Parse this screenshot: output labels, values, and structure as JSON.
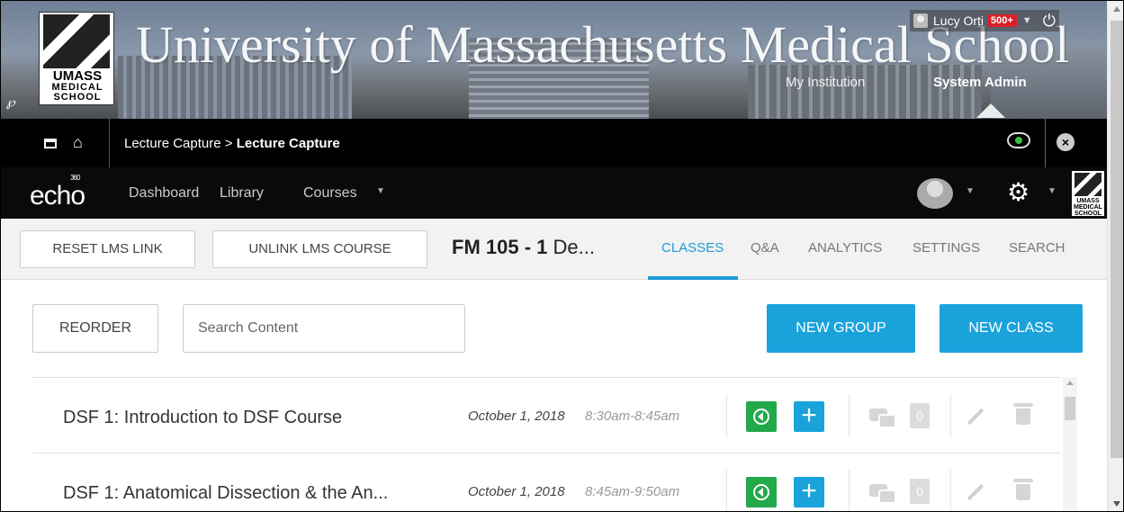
{
  "banner": {
    "title": "University of Massachusetts Medical School",
    "logo_lines": [
      "UMASS",
      "MEDICAL",
      "SCHOOL"
    ],
    "my_institution": "My Institution",
    "system_admin": "System Admin",
    "user_name": "Lucy Orti",
    "notification_count": "500+"
  },
  "breadcrumb": {
    "parent": "Lecture Capture",
    "separator": ">",
    "current": "Lecture Capture"
  },
  "echo": {
    "logo": "echo",
    "logo_sup": "360",
    "nav": [
      "Dashboard",
      "Library",
      "Courses"
    ],
    "mini_logo_text": "UMASS MEDICAL SCHOOL"
  },
  "course": {
    "reset_lms": "RESET LMS LINK",
    "unlink_lms": "UNLINK LMS COURSE",
    "code": "FM 105 - 1",
    "title_rest": "De...",
    "tabs": [
      "CLASSES",
      "Q&A",
      "ANALYTICS",
      "SETTINGS",
      "SEARCH"
    ],
    "active_tab": "CLASSES"
  },
  "content": {
    "reorder": "REORDER",
    "search_placeholder": "Search Content",
    "new_group": "NEW GROUP",
    "new_class": "NEW CLASS",
    "rows": [
      {
        "title": "DSF 1: Introduction to DSF Course",
        "date": "October 1, 2018",
        "time": "8:30am-8:45am",
        "qa_count": "0"
      },
      {
        "title": "DSF 1: Anatomical Dissection & the An...",
        "date": "October 1, 2018",
        "time": "8:45am-9:50am",
        "qa_count": "0"
      }
    ]
  },
  "colors": {
    "accent_blue": "#1aa3db",
    "record_green": "#23a84a",
    "notification_red": "#d9202a"
  }
}
